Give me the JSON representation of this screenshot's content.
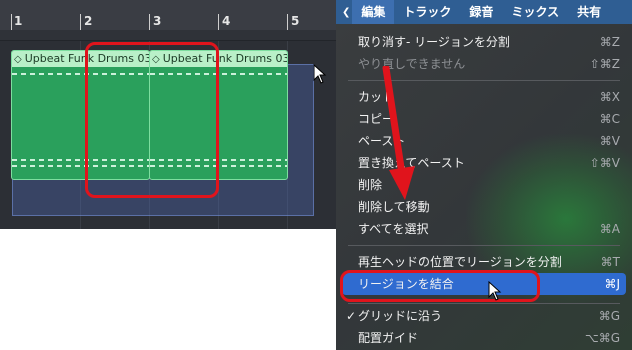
{
  "ruler": {
    "bars": [
      "1",
      "2",
      "3",
      "4",
      "5"
    ]
  },
  "regions": [
    {
      "name": "Upbeat Funk Drums 03"
    },
    {
      "name": "Upbeat Funk Drums 03"
    }
  ],
  "menubar": {
    "items": [
      "編集",
      "トラック",
      "録音",
      "ミックス",
      "共有"
    ],
    "active": "編集"
  },
  "edit_menu": {
    "undo": {
      "label": "取り消す- リージョンを分割",
      "shortcut": "⌘Z"
    },
    "redo": {
      "label": "やり直しできません",
      "shortcut": "⇧⌘Z"
    },
    "cut": {
      "label": "カット",
      "shortcut": "⌘X"
    },
    "copy": {
      "label": "コピー",
      "shortcut": "⌘C"
    },
    "paste": {
      "label": "ペースト",
      "shortcut": "⌘V"
    },
    "replace_paste": {
      "label": "置き換えてペースト",
      "shortcut": "⇧⌘V"
    },
    "delete": {
      "label": "削除",
      "shortcut": ""
    },
    "delete_move": {
      "label": "削除して移動",
      "shortcut": ""
    },
    "select_all": {
      "label": "すべてを選択",
      "shortcut": "⌘A"
    },
    "split_at_playhead": {
      "label": "再生ヘッドの位置でリージョンを分割",
      "shortcut": "⌘T"
    },
    "join_regions": {
      "label": "リージョンを結合",
      "shortcut": "⌘J"
    },
    "snap_to_grid": {
      "label": "グリッドに沿う",
      "shortcut": "⌘G",
      "checked": "✓"
    },
    "alignment_guides": {
      "label": "配置ガイド",
      "shortcut": "⌥⌘G"
    }
  },
  "colors": {
    "menubar_bg": "#2f5e93",
    "highlight": "#2f6bd0",
    "annotation_red": "#e0141c",
    "region_green": "#2aa05c"
  }
}
